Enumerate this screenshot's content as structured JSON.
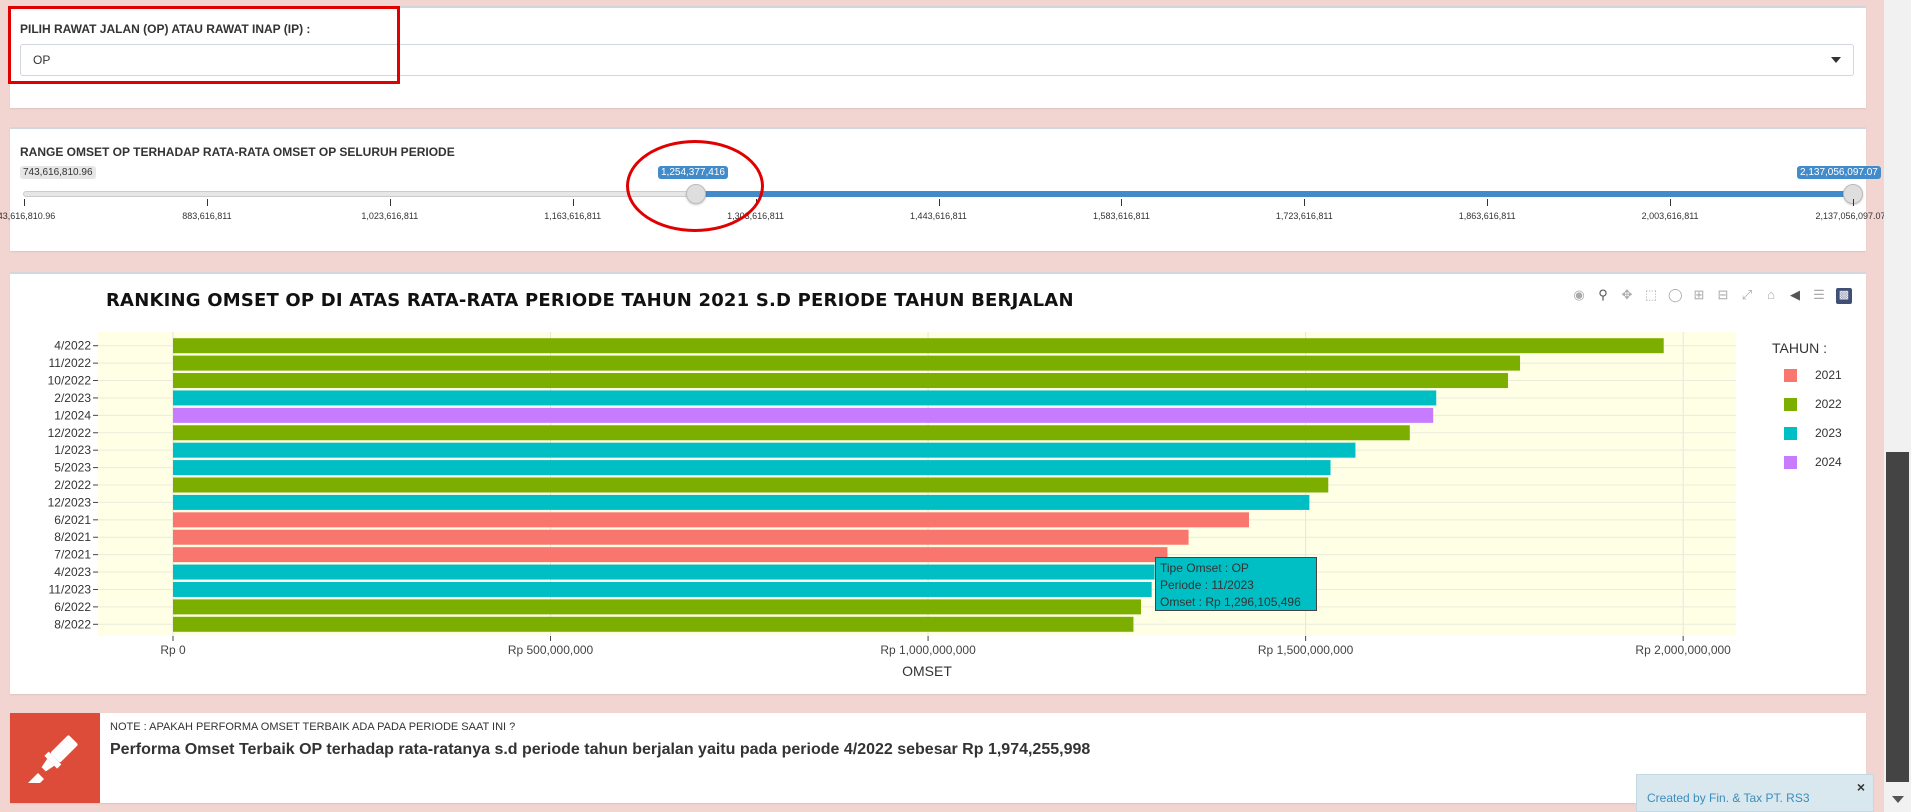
{
  "filter": {
    "label": "PILIH RAWAT JALAN (OP) ATAU RAWAT INAP (IP) :",
    "selected": "OP"
  },
  "range": {
    "label": "RANGE OMSET OP TERHADAP RATA-RATA OMSET OP SELURUH PERIODE",
    "min_label": "743,616,810.96",
    "from_value": "1,254,377,416",
    "to_value": "2,137,056,097.07",
    "from_fraction": 0.366,
    "ticks": [
      "743,616,810.96",
      "883,616,811",
      "1,023,616,811",
      "1,163,616,811",
      "1,303,616,811",
      "1,443,616,811",
      "1,583,616,811",
      "1,723,616,811",
      "1,863,616,811",
      "2,003,616,811",
      "2,137,056,097.077"
    ]
  },
  "chart_data": {
    "type": "bar",
    "orientation": "horizontal",
    "title": "RANKING OMSET OP DI ATAS RATA-RATA PERIODE TAHUN 2021 S.D PERIODE TAHUN BERJALAN",
    "xlabel": "OMSET",
    "ylabel": "",
    "xlim": [
      0,
      2070000000
    ],
    "x_ticks": [
      "Rp 0",
      "Rp 500,000,000",
      "Rp 1,000,000,000",
      "Rp 1,500,000,000",
      "Rp 2,000,000,000"
    ],
    "x_tick_values": [
      0,
      500000000,
      1000000000,
      1500000000,
      2000000000
    ],
    "legend_title": "TAHUN :",
    "legend_position": "right",
    "colors": {
      "2021": "#f8766d",
      "2022": "#7cae00",
      "2023": "#00bfc4",
      "2024": "#c77cff"
    },
    "legend": [
      "2021",
      "2022",
      "2023",
      "2024"
    ],
    "categories": [
      "4/2022",
      "11/2022",
      "10/2022",
      "2/2023",
      "1/2024",
      "12/2022",
      "1/2023",
      "5/2023",
      "2/2022",
      "12/2023",
      "6/2021",
      "8/2021",
      "7/2021",
      "4/2023",
      "11/2023",
      "6/2022",
      "8/2022"
    ],
    "values": [
      1974255998,
      1784000000,
      1768000000,
      1673000000,
      1669000000,
      1638000000,
      1566000000,
      1533000000,
      1530000000,
      1505000000,
      1425000000,
      1345000000,
      1317000000,
      1300000000,
      1296105496,
      1282000000,
      1272000000
    ],
    "years": [
      "2022",
      "2022",
      "2022",
      "2023",
      "2024",
      "2022",
      "2023",
      "2023",
      "2022",
      "2023",
      "2021",
      "2021",
      "2021",
      "2023",
      "2023",
      "2022",
      "2022"
    ],
    "grid": true,
    "tooltip": {
      "line1": "Tipe Omset : OP",
      "line2": "Periode : 11/2023",
      "line3": "Omset : Rp 1,296,105,496"
    }
  },
  "note": {
    "small": "NOTE : APAKAH PERFORMA OMSET TERBAIK ADA PADA PERIODE SAAT INI ?",
    "main": "Performa Omset Terbaik OP terhadap rata-ratanya s.d periode tahun berjalan yaitu pada periode 4/2022 sebesar Rp 1,974,255,998"
  },
  "toast": {
    "text": "Created by Fin. & Tax PT. RS3",
    "close": "×"
  },
  "modebar_icons": [
    "camera-icon",
    "zoom-icon",
    "pan-icon",
    "box-select-icon",
    "lasso-icon",
    "zoom-in-icon",
    "zoom-out-icon",
    "autoscale-icon",
    "reset-axes-icon",
    "spike-lines-icon",
    "compare-hover-icon",
    "plotly-logo-icon"
  ]
}
